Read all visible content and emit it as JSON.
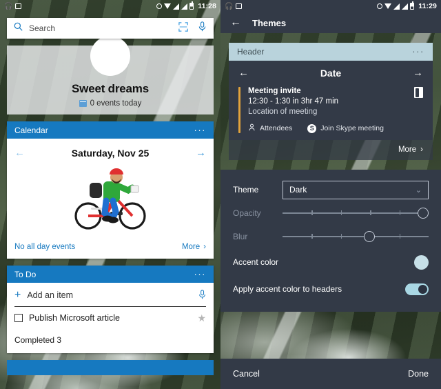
{
  "left": {
    "statusbar": {
      "time": "11:28",
      "icons": [
        "headphones-icon",
        "photo-icon",
        "alarm-icon",
        "wifi-icon",
        "signal-icon",
        "signal-icon",
        "battery-icon"
      ]
    },
    "search": {
      "placeholder": "Search",
      "scan_icon": "scan-icon",
      "mic_icon": "microphone-icon"
    },
    "hero": {
      "greeting": "Sweet dreams",
      "events_summary": "0 events today"
    },
    "calendar": {
      "header": "Calendar",
      "overflow": "···",
      "prev": "←",
      "next": "→",
      "date": "Saturday, Nov 25",
      "empty_text": "No all day events",
      "more": "More",
      "more_chevron": "›"
    },
    "todo": {
      "header": "To Do",
      "overflow": "···",
      "add_label": "Add an item",
      "add_plus": "+",
      "mic_icon": "microphone-icon",
      "items": [
        {
          "label": "Publish Microsoft article",
          "checked": false,
          "star": "★"
        }
      ],
      "completed": "Completed 3"
    }
  },
  "right": {
    "statusbar": {
      "time": "11:29"
    },
    "topbar": {
      "back": "←",
      "title": "Themes"
    },
    "preview": {
      "header_label": "Header",
      "overflow": "···",
      "prev": "←",
      "next": "→",
      "date": "Date",
      "event_title": "Meeting invite",
      "event_time": "12:30 - 1:30 in 3hr 47 min",
      "event_location": "Location of meeting",
      "attendees": "Attendees",
      "skype": "Join Skype meeting",
      "skype_glyph": "S",
      "more": "More",
      "more_chevron": "›"
    },
    "settings": {
      "theme_label": "Theme",
      "theme_value": "Dark",
      "theme_chevron": "⌄",
      "opacity_label": "Opacity",
      "opacity_value": 100,
      "blur_label": "Blur",
      "blur_value": 60,
      "accent_label": "Accent color",
      "accent_color": "#c7e0e8",
      "apply_accent_label": "Apply accent color to headers",
      "apply_accent_on": true
    },
    "footer": {
      "cancel": "Cancel",
      "done": "Done"
    }
  }
}
